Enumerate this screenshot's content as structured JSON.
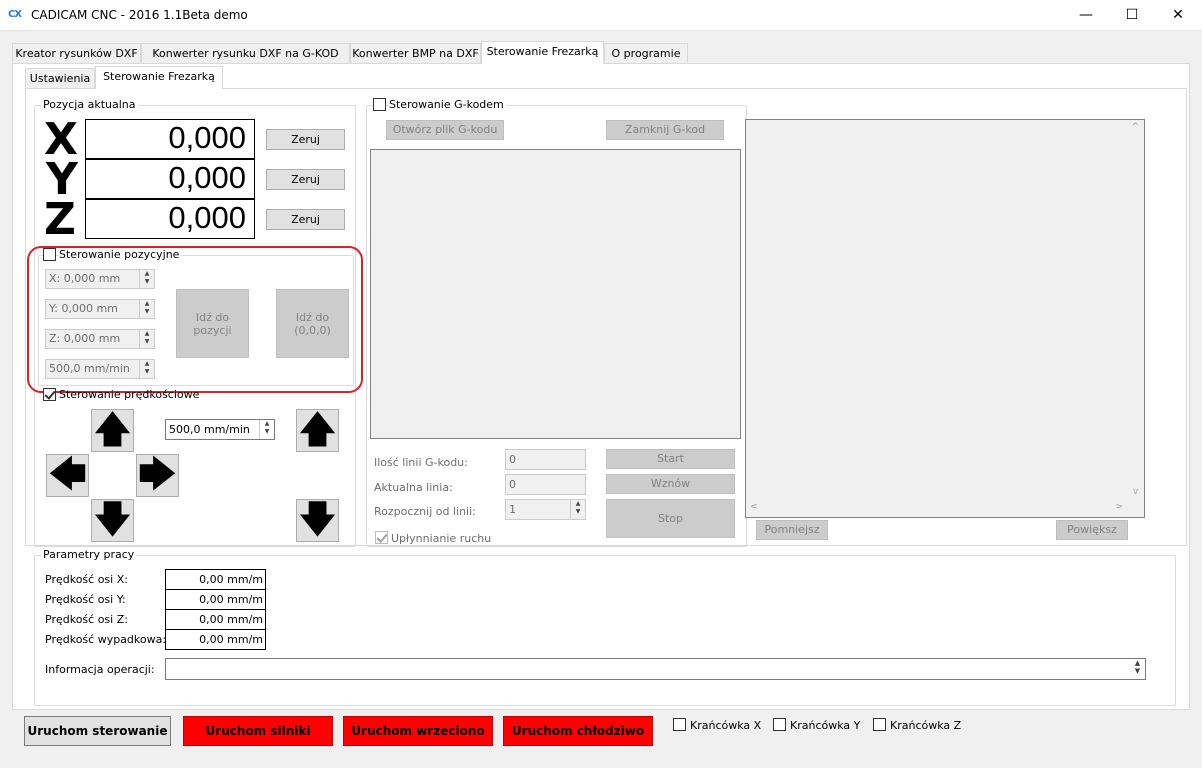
{
  "window": {
    "logo_text": "CX",
    "title": "CADICAM CNC - 2016 1.1Beta demo",
    "minimize": "—",
    "maximize": "☐",
    "close": "✕"
  },
  "main_tabs": [
    "Kreator rysunków DXF",
    "Konwerter rysunku DXF na G-KOD",
    "Konwerter BMP na DXF",
    "Sterowanie Frezarką",
    "O programie"
  ],
  "sub_tabs": [
    "Ustawienia",
    "Sterowanie Frezarką"
  ],
  "position": {
    "group_title": "Pozycja aktualna",
    "axes": [
      {
        "letter": "X",
        "value": "0,000",
        "reset": "Zeruj"
      },
      {
        "letter": "Y",
        "value": "0,000",
        "reset": "Zeruj"
      },
      {
        "letter": "Z",
        "value": "0,000",
        "reset": "Zeruj"
      }
    ]
  },
  "positional": {
    "title": "Sterowanie pozycyjne",
    "x": "X: 0,000 mm",
    "y": "Y: 0,000 mm",
    "z": "Z: 0,000 mm",
    "feed": "500,0 mm/min",
    "goto_label": "Idź do pozycji",
    "home_label": "Idź do (0,0,0)"
  },
  "speed_ctrl": {
    "title": "Sterowanie prędkościowe",
    "feed": "500,0 mm/min"
  },
  "gcode": {
    "title": "Sterowanie G-kodem",
    "open": "Otwórz plik G-kodu",
    "close": "Zamknij G-kod",
    "lines_label": "Ilość linii G-kodu:",
    "lines_value": "0",
    "current_label": "Aktualna linia:",
    "current_value": "0",
    "start_from_label": "Rozpocznij od linii:",
    "start_from_value": "1",
    "smoothing": "Upłynnianie ruchu",
    "start": "Start",
    "resume": "Wznów",
    "stop": "Stop",
    "zoom_out": "Pomniejsz",
    "zoom_in": "Powiększ"
  },
  "params": {
    "title": "Parametry pracy",
    "rows": [
      {
        "label": "Prędkość osi X:",
        "value": "0,00 mm/m"
      },
      {
        "label": "Prędkość osi Y:",
        "value": "0,00 mm/m"
      },
      {
        "label": "Prędkość osi Z:",
        "value": "0,00 mm/m"
      },
      {
        "label": "Prędkość wypadkowa:",
        "value": "0,00 mm/m"
      }
    ],
    "info_label": "Informacja operacji:"
  },
  "bottom": {
    "start_control": "Uruchom sterowanie",
    "motors": "Uruchom silniki",
    "spindle": "Uruchom wrzeciono",
    "coolant": "Uruchom chłodziwo",
    "limit_x": "Krańcówka X",
    "limit_y": "Krańcówka Y",
    "limit_z": "Krańcówka Z"
  },
  "colors": {
    "highlight_frame": "#d8232a",
    "red_button": "#ff0000"
  }
}
